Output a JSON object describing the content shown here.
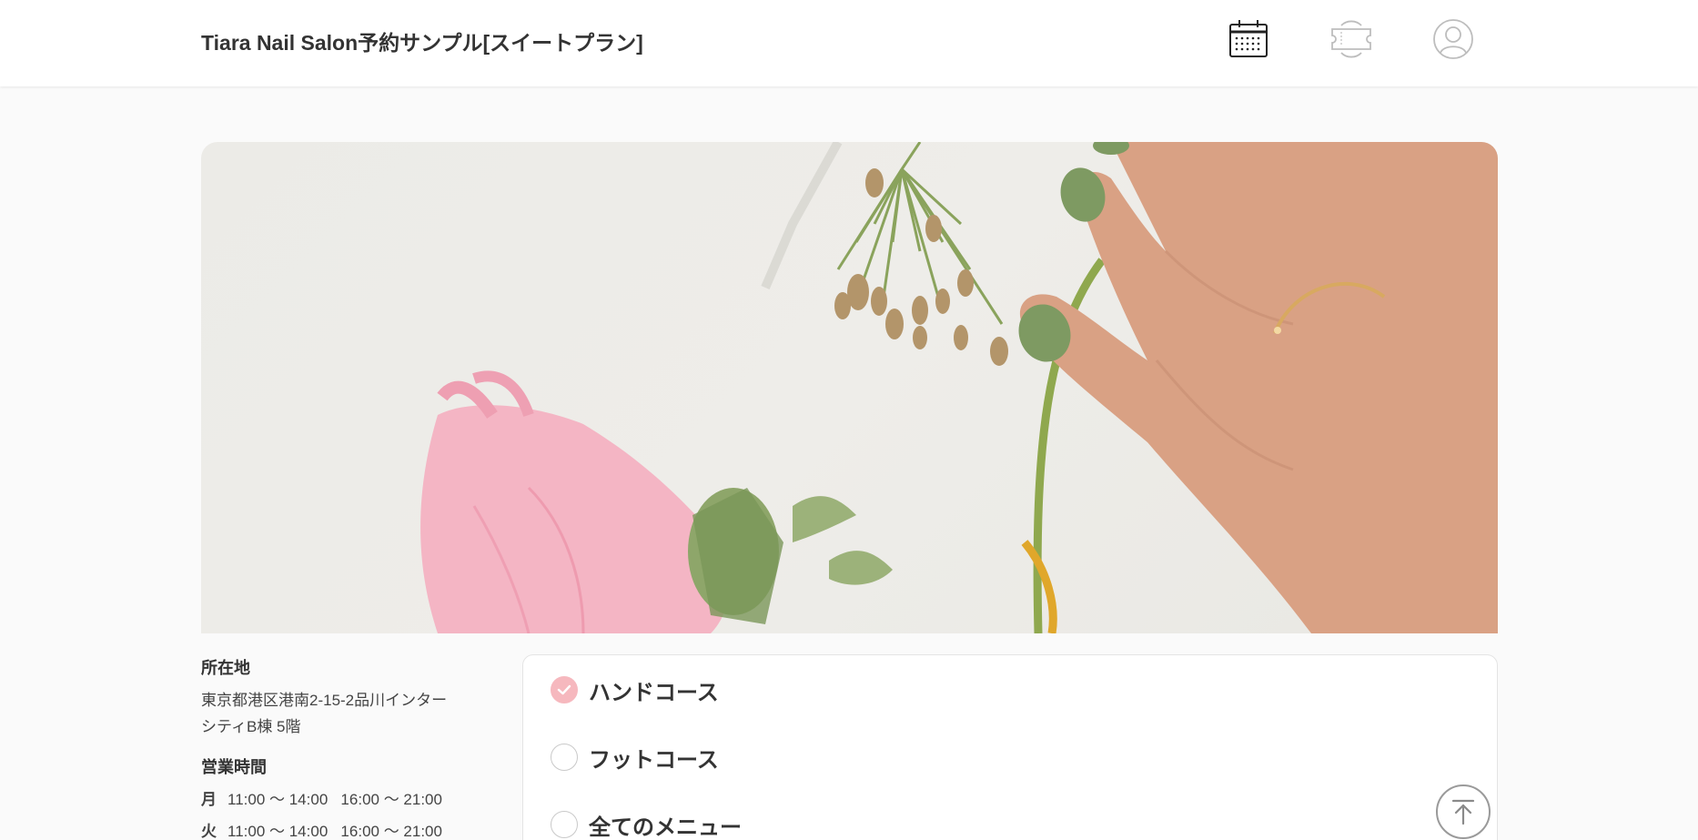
{
  "header": {
    "site_title": "Tiara Nail Salon予約サンプル[スイートプラン]",
    "nav_icons": [
      "calendar-icon",
      "ticket-icon",
      "user-icon"
    ]
  },
  "hero": {
    "image_subject": "hand-with-green-nails-and-flowers-photo"
  },
  "info": {
    "location_heading": "所在地",
    "address_line1": "東京都港区港南2-15-2品川インター",
    "address_line2": "シティB棟 5階",
    "hours_heading": "営業時間",
    "hours": [
      {
        "day": "月",
        "slots": "11:00 〜 14:00   16:00 〜 21:00"
      },
      {
        "day": "火",
        "slots": "11:00 〜 14:00   16:00 〜 21:00"
      }
    ]
  },
  "menu": {
    "options": [
      {
        "label": "ハンドコース",
        "selected": true
      },
      {
        "label": "フットコース",
        "selected": false
      },
      {
        "label": "全てのメニュー",
        "selected": false
      }
    ]
  },
  "colors": {
    "accent_pink": "#f6b8be",
    "text": "#333333",
    "background": "#fafafa",
    "nail_green": "#7e9a62"
  },
  "scroll_top_icon": "arrow-up-to-top-icon"
}
